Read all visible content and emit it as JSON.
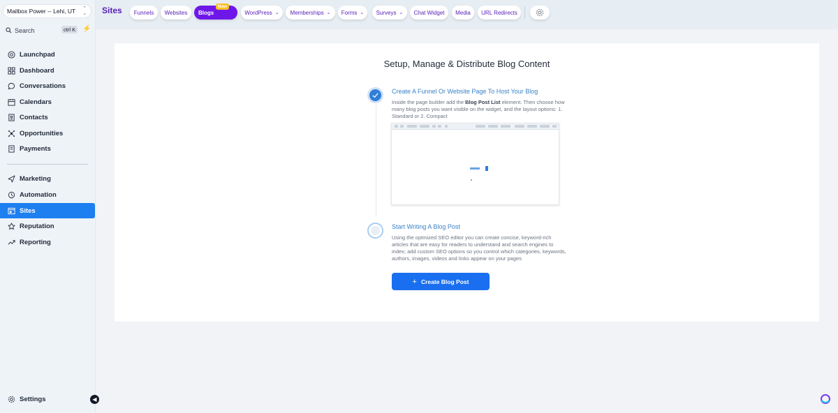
{
  "sidebar": {
    "account": "Mailbox Power -- Lehi, UT",
    "search": {
      "placeholder": "Search",
      "shortcut": "ctrl K"
    },
    "items": [
      {
        "label": "Launchpad",
        "icon": "launchpad-icon"
      },
      {
        "label": "Dashboard",
        "icon": "dashboard-icon"
      },
      {
        "label": "Conversations",
        "icon": "chat-icon"
      },
      {
        "label": "Calendars",
        "icon": "calendar-icon"
      },
      {
        "label": "Contacts",
        "icon": "contacts-icon"
      },
      {
        "label": "Opportunities",
        "icon": "opportunities-icon"
      },
      {
        "label": "Payments",
        "icon": "payments-icon"
      },
      {
        "label": "Marketing",
        "icon": "send-icon"
      },
      {
        "label": "Automation",
        "icon": "automation-icon"
      },
      {
        "label": "Sites",
        "icon": "sites-icon",
        "active": true
      },
      {
        "label": "Reputation",
        "icon": "star-icon"
      },
      {
        "label": "Reporting",
        "icon": "trend-icon"
      }
    ],
    "settings": "Settings"
  },
  "topbar": {
    "title": "Sites",
    "tabs": [
      {
        "label": "Funnels"
      },
      {
        "label": "Websites"
      },
      {
        "label": "Blogs",
        "badge": "New",
        "active": true
      },
      {
        "label": "WordPress",
        "dropdown": true
      },
      {
        "label": "Memberships",
        "dropdown": true
      },
      {
        "label": "Forms",
        "dropdown": true
      },
      {
        "label": "Surveys",
        "dropdown": true
      },
      {
        "label": "Chat Widget"
      },
      {
        "label": "Media"
      },
      {
        "label": "URL Redirects"
      }
    ]
  },
  "main": {
    "heading": "Setup, Manage & Distribute Blog Content",
    "step1": {
      "title": "Create A Funnel Or Website Page To Host Your Blog",
      "desc_before": "Inside the page builder add the ",
      "desc_bold": "Blog Post List",
      "desc_after": " element. Then choose how many blog posts you want visible on the widget, and the layout options: 1. Standard or 2. Compact",
      "status": "completed"
    },
    "step2": {
      "title": "Start Writing A Blog Post",
      "desc": "Using the optmized SEO editor you can create concise, keyword-rich articles that are easy for readers to understand and search engines to index; add custom SEO options so you control which categories, keywords, authors, images, videos and links appear on your pages",
      "status": "pending"
    },
    "create_button": "Create Blog Post"
  },
  "colors": {
    "accent": "#1d7ff0",
    "brand_purple": "#6d18e8",
    "badge": "#fbbf24"
  }
}
